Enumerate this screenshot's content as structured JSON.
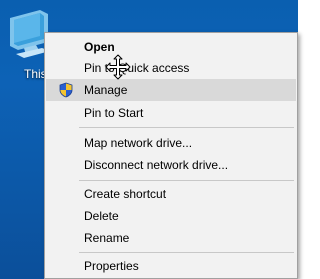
{
  "desktop": {
    "icon_name": "this-pc-icon",
    "label": "This PC",
    "background_color": "#0d62b6"
  },
  "context_menu": {
    "items": [
      {
        "label": "Open",
        "bold": true
      },
      {
        "label": "Pin to Quick access"
      },
      {
        "label": "Manage",
        "icon": "uac-shield-icon",
        "highlighted": true
      },
      {
        "label": "Pin to Start"
      },
      {
        "label": "Map network drive..."
      },
      {
        "label": "Disconnect network drive..."
      },
      {
        "label": "Create shortcut"
      },
      {
        "label": "Delete"
      },
      {
        "label": "Rename"
      },
      {
        "label": "Properties"
      }
    ],
    "highlight_color": "#d9d9d9",
    "background_color": "#f2f2f2"
  },
  "cursor": {
    "icon_name": "move-cursor-icon"
  }
}
